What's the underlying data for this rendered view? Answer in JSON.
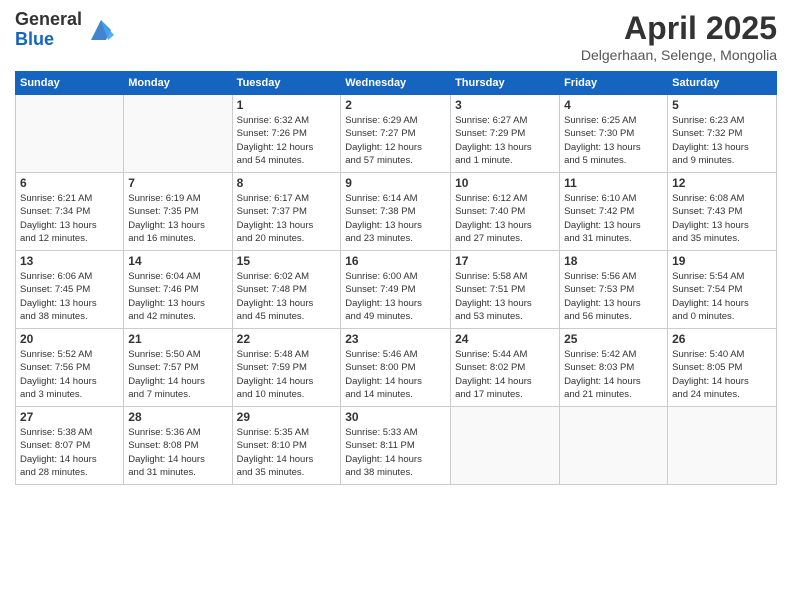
{
  "logo": {
    "general": "General",
    "blue": "Blue"
  },
  "title": "April 2025",
  "subtitle": "Delgerhaan, Selenge, Mongolia",
  "weekdays": [
    "Sunday",
    "Monday",
    "Tuesday",
    "Wednesday",
    "Thursday",
    "Friday",
    "Saturday"
  ],
  "weeks": [
    [
      {
        "day": "",
        "info": ""
      },
      {
        "day": "",
        "info": ""
      },
      {
        "day": "1",
        "info": "Sunrise: 6:32 AM\nSunset: 7:26 PM\nDaylight: 12 hours\nand 54 minutes."
      },
      {
        "day": "2",
        "info": "Sunrise: 6:29 AM\nSunset: 7:27 PM\nDaylight: 12 hours\nand 57 minutes."
      },
      {
        "day": "3",
        "info": "Sunrise: 6:27 AM\nSunset: 7:29 PM\nDaylight: 13 hours\nand 1 minute."
      },
      {
        "day": "4",
        "info": "Sunrise: 6:25 AM\nSunset: 7:30 PM\nDaylight: 13 hours\nand 5 minutes."
      },
      {
        "day": "5",
        "info": "Sunrise: 6:23 AM\nSunset: 7:32 PM\nDaylight: 13 hours\nand 9 minutes."
      }
    ],
    [
      {
        "day": "6",
        "info": "Sunrise: 6:21 AM\nSunset: 7:34 PM\nDaylight: 13 hours\nand 12 minutes."
      },
      {
        "day": "7",
        "info": "Sunrise: 6:19 AM\nSunset: 7:35 PM\nDaylight: 13 hours\nand 16 minutes."
      },
      {
        "day": "8",
        "info": "Sunrise: 6:17 AM\nSunset: 7:37 PM\nDaylight: 13 hours\nand 20 minutes."
      },
      {
        "day": "9",
        "info": "Sunrise: 6:14 AM\nSunset: 7:38 PM\nDaylight: 13 hours\nand 23 minutes."
      },
      {
        "day": "10",
        "info": "Sunrise: 6:12 AM\nSunset: 7:40 PM\nDaylight: 13 hours\nand 27 minutes."
      },
      {
        "day": "11",
        "info": "Sunrise: 6:10 AM\nSunset: 7:42 PM\nDaylight: 13 hours\nand 31 minutes."
      },
      {
        "day": "12",
        "info": "Sunrise: 6:08 AM\nSunset: 7:43 PM\nDaylight: 13 hours\nand 35 minutes."
      }
    ],
    [
      {
        "day": "13",
        "info": "Sunrise: 6:06 AM\nSunset: 7:45 PM\nDaylight: 13 hours\nand 38 minutes."
      },
      {
        "day": "14",
        "info": "Sunrise: 6:04 AM\nSunset: 7:46 PM\nDaylight: 13 hours\nand 42 minutes."
      },
      {
        "day": "15",
        "info": "Sunrise: 6:02 AM\nSunset: 7:48 PM\nDaylight: 13 hours\nand 45 minutes."
      },
      {
        "day": "16",
        "info": "Sunrise: 6:00 AM\nSunset: 7:49 PM\nDaylight: 13 hours\nand 49 minutes."
      },
      {
        "day": "17",
        "info": "Sunrise: 5:58 AM\nSunset: 7:51 PM\nDaylight: 13 hours\nand 53 minutes."
      },
      {
        "day": "18",
        "info": "Sunrise: 5:56 AM\nSunset: 7:53 PM\nDaylight: 13 hours\nand 56 minutes."
      },
      {
        "day": "19",
        "info": "Sunrise: 5:54 AM\nSunset: 7:54 PM\nDaylight: 14 hours\nand 0 minutes."
      }
    ],
    [
      {
        "day": "20",
        "info": "Sunrise: 5:52 AM\nSunset: 7:56 PM\nDaylight: 14 hours\nand 3 minutes."
      },
      {
        "day": "21",
        "info": "Sunrise: 5:50 AM\nSunset: 7:57 PM\nDaylight: 14 hours\nand 7 minutes."
      },
      {
        "day": "22",
        "info": "Sunrise: 5:48 AM\nSunset: 7:59 PM\nDaylight: 14 hours\nand 10 minutes."
      },
      {
        "day": "23",
        "info": "Sunrise: 5:46 AM\nSunset: 8:00 PM\nDaylight: 14 hours\nand 14 minutes."
      },
      {
        "day": "24",
        "info": "Sunrise: 5:44 AM\nSunset: 8:02 PM\nDaylight: 14 hours\nand 17 minutes."
      },
      {
        "day": "25",
        "info": "Sunrise: 5:42 AM\nSunset: 8:03 PM\nDaylight: 14 hours\nand 21 minutes."
      },
      {
        "day": "26",
        "info": "Sunrise: 5:40 AM\nSunset: 8:05 PM\nDaylight: 14 hours\nand 24 minutes."
      }
    ],
    [
      {
        "day": "27",
        "info": "Sunrise: 5:38 AM\nSunset: 8:07 PM\nDaylight: 14 hours\nand 28 minutes."
      },
      {
        "day": "28",
        "info": "Sunrise: 5:36 AM\nSunset: 8:08 PM\nDaylight: 14 hours\nand 31 minutes."
      },
      {
        "day": "29",
        "info": "Sunrise: 5:35 AM\nSunset: 8:10 PM\nDaylight: 14 hours\nand 35 minutes."
      },
      {
        "day": "30",
        "info": "Sunrise: 5:33 AM\nSunset: 8:11 PM\nDaylight: 14 hours\nand 38 minutes."
      },
      {
        "day": "",
        "info": ""
      },
      {
        "day": "",
        "info": ""
      },
      {
        "day": "",
        "info": ""
      }
    ]
  ]
}
